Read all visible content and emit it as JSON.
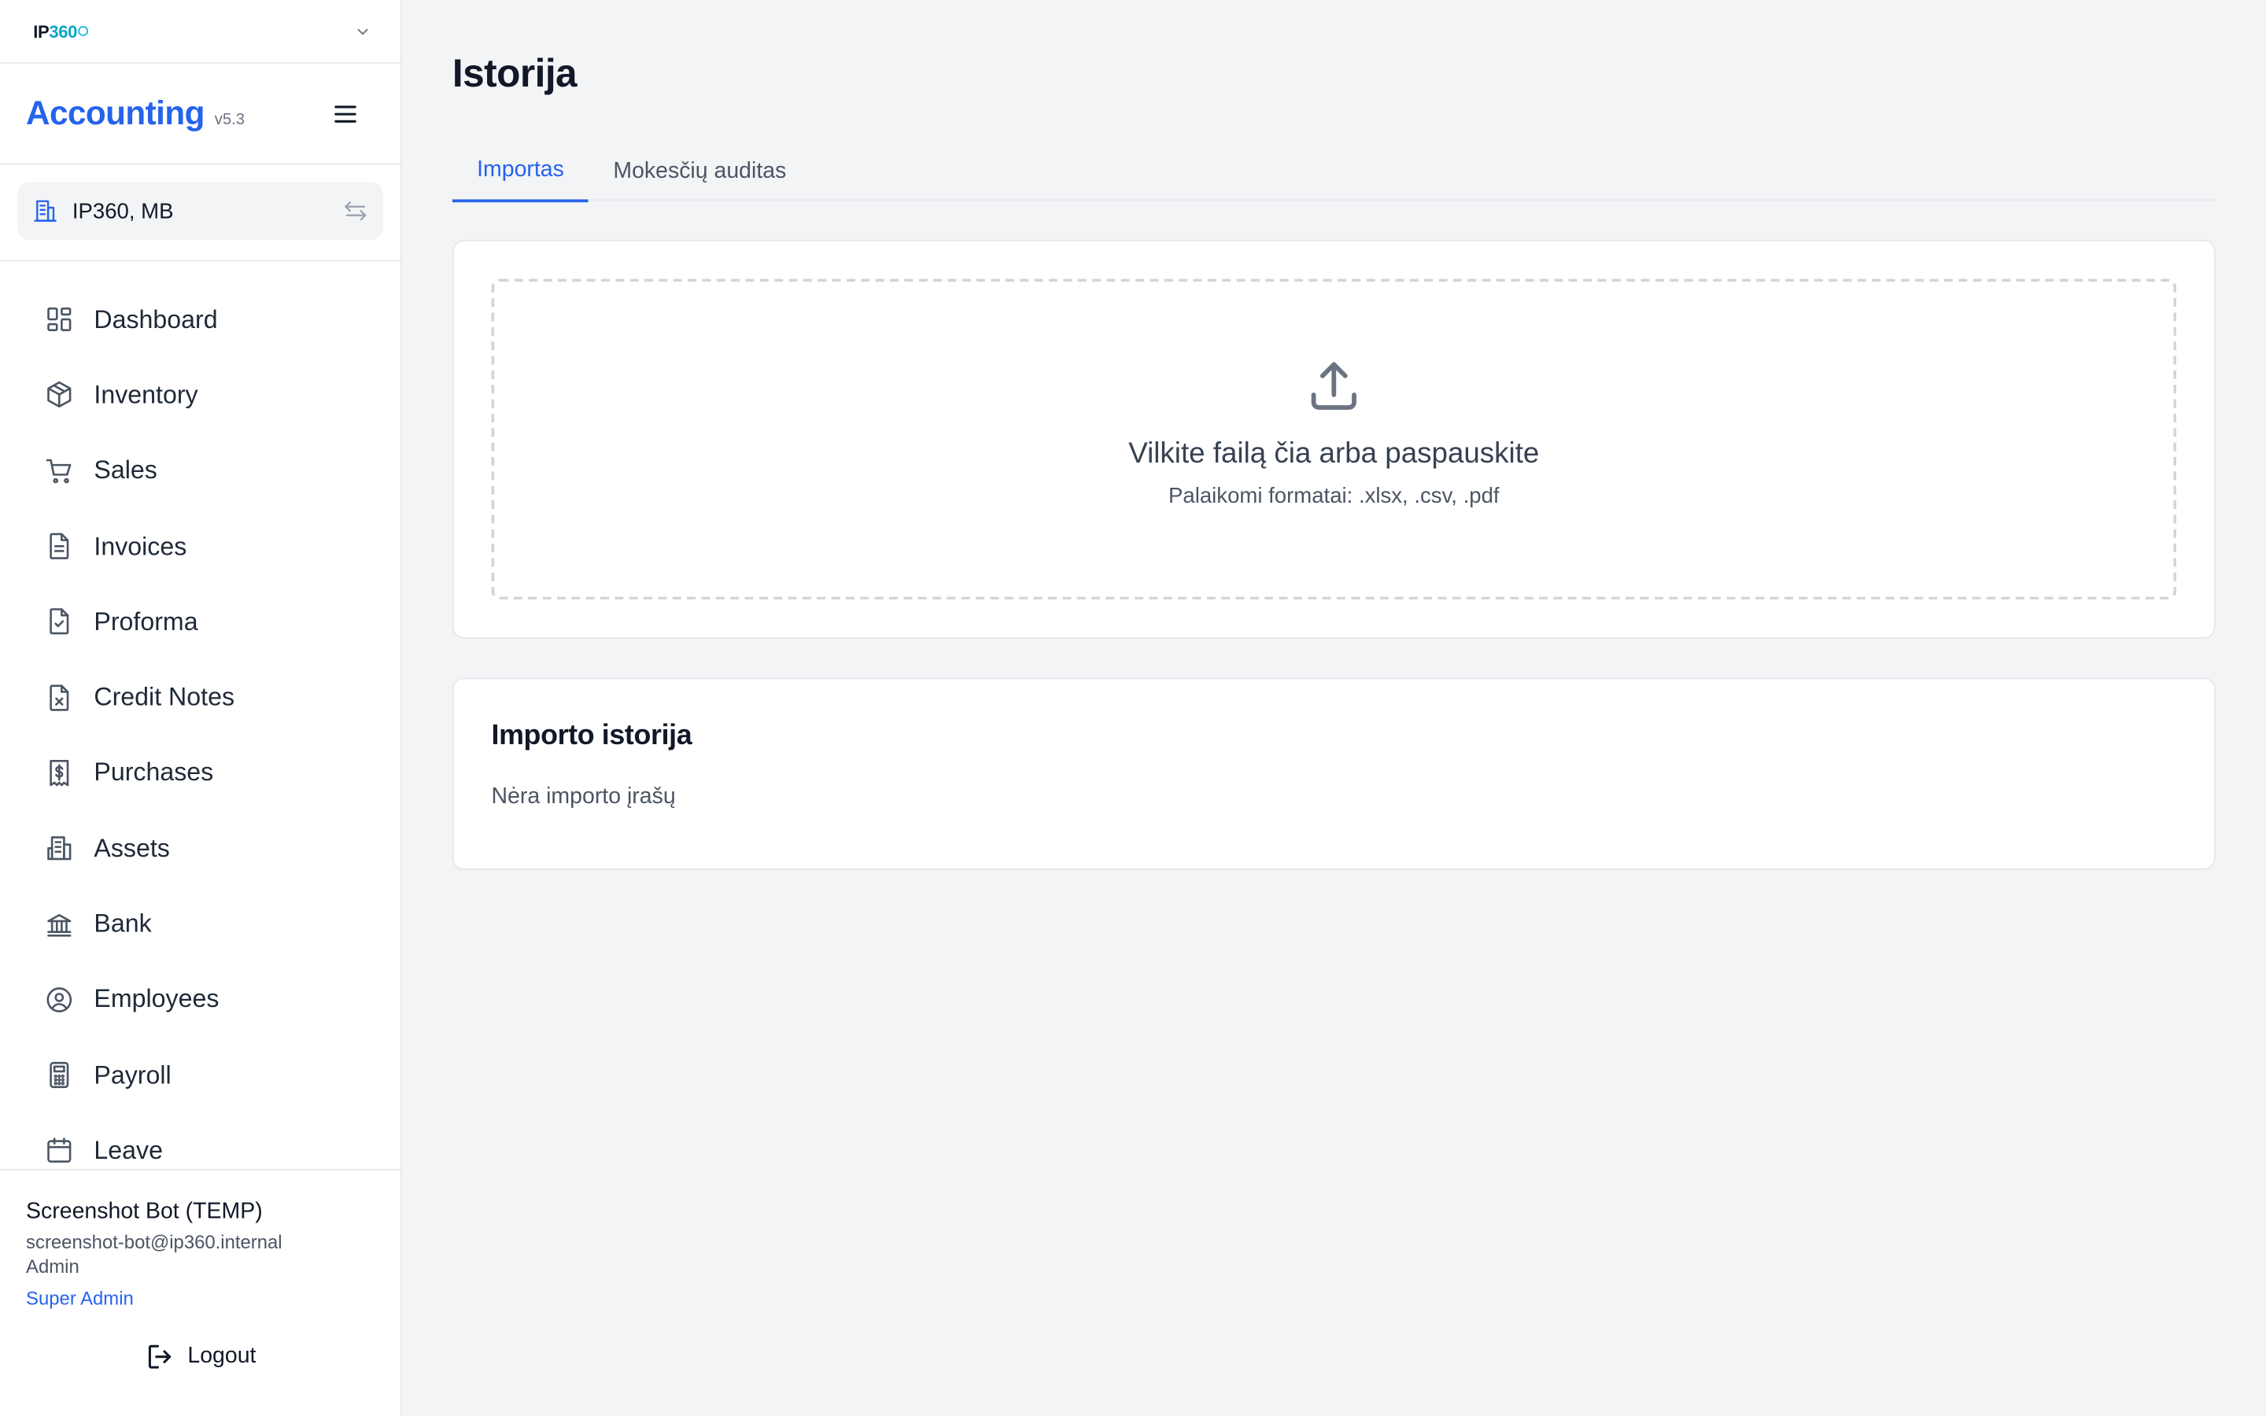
{
  "brand": {
    "logo_prefix": "IP",
    "logo_num": "360"
  },
  "app": {
    "name": "Accounting",
    "version": "v5.3"
  },
  "company": {
    "name": "IP360, MB"
  },
  "nav": [
    {
      "label": "Dashboard",
      "icon": "dashboard-icon"
    },
    {
      "label": "Inventory",
      "icon": "box-icon"
    },
    {
      "label": "Sales",
      "icon": "cart-icon"
    },
    {
      "label": "Invoices",
      "icon": "document-icon"
    },
    {
      "label": "Proforma",
      "icon": "document-check-icon"
    },
    {
      "label": "Credit Notes",
      "icon": "document-x-icon"
    },
    {
      "label": "Purchases",
      "icon": "receipt-dollar-icon"
    },
    {
      "label": "Assets",
      "icon": "building-icon"
    },
    {
      "label": "Bank",
      "icon": "bank-icon"
    },
    {
      "label": "Employees",
      "icon": "user-circle-icon"
    },
    {
      "label": "Payroll",
      "icon": "calculator-icon"
    },
    {
      "label": "Leave",
      "icon": "calendar-icon"
    }
  ],
  "user": {
    "name": "Screenshot Bot (TEMP)",
    "email": "screenshot-bot@ip360.internal",
    "role": "Admin",
    "super": "Super Admin",
    "logout_label": "Logout"
  },
  "page": {
    "title": "Istorija"
  },
  "tabs": [
    {
      "label": "Importas",
      "active": true
    },
    {
      "label": "Mokesčių auditas",
      "active": false
    }
  ],
  "upload": {
    "title": "Vilkite failą čia arba paspauskite",
    "formats": "Palaikomi formatai: .xlsx, .csv, .pdf"
  },
  "history": {
    "title": "Importo istorija",
    "empty": "Nėra importo įrašų"
  },
  "colors": {
    "accent": "#2563eb",
    "logo_accent": "#0ea5c6"
  }
}
